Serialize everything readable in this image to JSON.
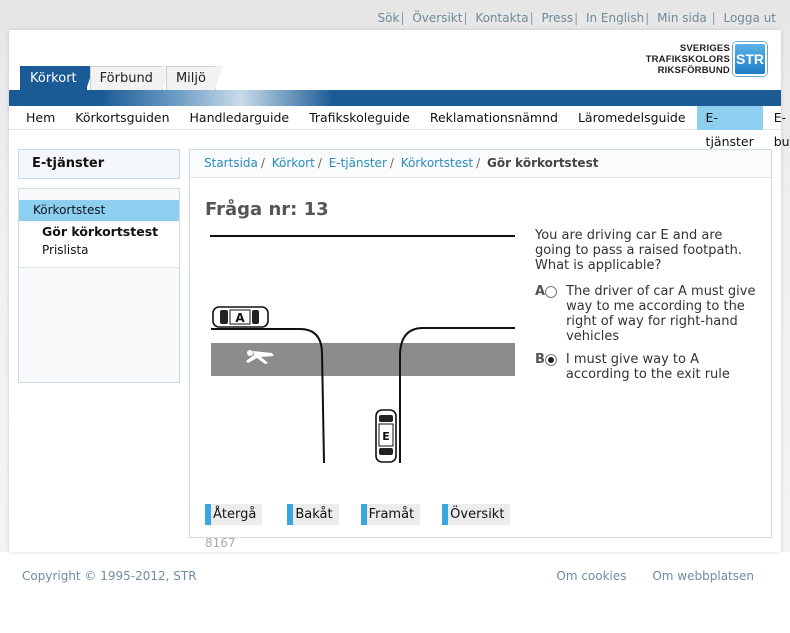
{
  "utility_links": [
    "Sök",
    "Översikt",
    "Kontakta",
    "Press",
    "In English",
    "Min sida",
    "Logga ut"
  ],
  "logo": {
    "line1": "SVERIGES",
    "line2": "TRAFIKSKOLORS",
    "line3": "RIKSFÖRBUND",
    "mark": "STR"
  },
  "top_tabs": [
    "Körkort",
    "Förbund",
    "Miljö"
  ],
  "main_nav": [
    "Hem",
    "Körkortsguiden",
    "Handledarguide",
    "Trafikskoleguide",
    "Reklamationsnämnd",
    "Läromedelsguide",
    "E-tjänster",
    "E-butik"
  ],
  "sidebar": {
    "title": "E-tjänster",
    "item": "Körkortstest",
    "sub1": "Gör körkortstest",
    "sub2": "Prislista"
  },
  "breadcrumb": {
    "items": [
      "Startsida",
      "Körkort",
      "E-tjänster",
      "Körkortstest"
    ],
    "current": "Gör körkortstest"
  },
  "question": {
    "title": "Fråga nr: 13",
    "text": "You are driving car E and are going to pass a raised footpath. What is applicable?",
    "answer_a": {
      "letter": "A",
      "text": "The driver of car A must give way to me according to the right of way for right-hand vehicles",
      "selected": false
    },
    "answer_b": {
      "letter": "B",
      "text": "I must give way to A according to the exit rule",
      "selected": true
    },
    "car_a_label": "A",
    "car_e_label": "E"
  },
  "buttons": {
    "back": "Återgå",
    "prev": "Bakåt",
    "next": "Framåt",
    "overview": "Översikt"
  },
  "question_id": "8167",
  "footer": {
    "copyright": "Copyright © 1995-2012, STR",
    "cookies": "Om cookies",
    "about": "Om webbplatsen"
  },
  "colors": {
    "brand_blue": "#1a5b96",
    "accent_light_blue": "#8ccfef",
    "link_blue": "#2a8bbf"
  }
}
